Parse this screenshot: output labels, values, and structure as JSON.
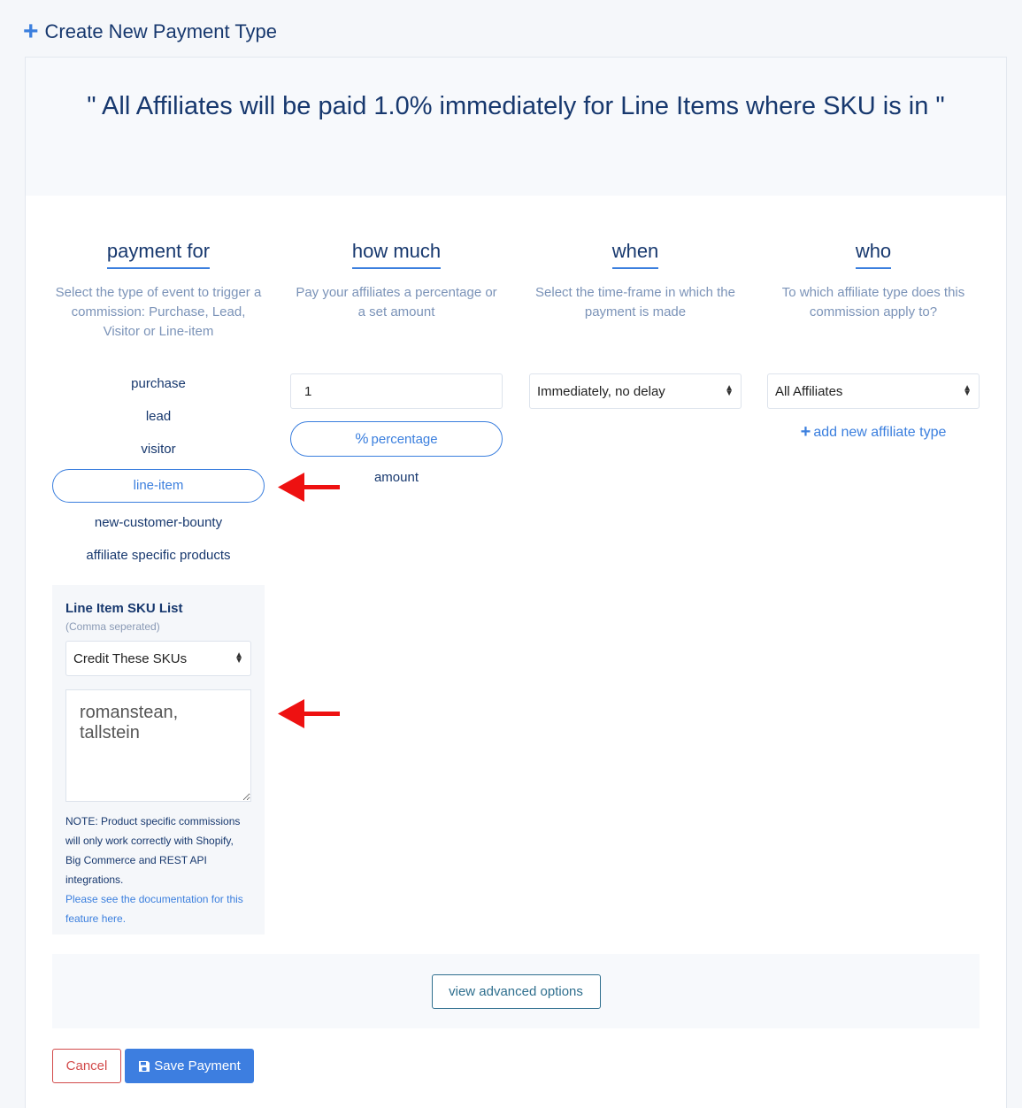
{
  "header": {
    "title": "Create New Payment Type",
    "icon": "plus-icon"
  },
  "summary": "\" All Affiliates will be paid 1.0% immediately for Line Items where SKU is in \"",
  "columns": {
    "payment_for": {
      "title": "payment for",
      "desc": "Select the type of event to trigger a commission: Purchase, Lead, Visitor or Line-item"
    },
    "how_much": {
      "title": "how much",
      "desc": "Pay your affiliates a percentage or a set amount"
    },
    "when": {
      "title": "when",
      "desc": "Select the time-frame in which the payment is made"
    },
    "who": {
      "title": "who",
      "desc": "To which affiliate type does this commission apply to?"
    }
  },
  "payment_options": [
    "purchase",
    "lead",
    "visitor",
    "line-item",
    "new-customer-bounty",
    "affiliate specific products"
  ],
  "selected_payment_option": "line-item",
  "sku": {
    "title": "Line Item SKU List",
    "subtitle": "(Comma seperated)",
    "mode": "Credit These SKUs",
    "value": "romanstean, tallstein",
    "note": "NOTE: Product specific commissions will only work correctly with Shopify, Big Commerce and REST API integrations.",
    "doc_link": "Please see the documentation for this feature here."
  },
  "how_much": {
    "value": "1",
    "percentage_label": "percentage",
    "amount_label": "amount",
    "selected": "percentage"
  },
  "when": {
    "selected": "Immediately, no delay"
  },
  "who": {
    "selected": "All Affiliates",
    "add_label": "add new affiliate type"
  },
  "buttons": {
    "advanced": "view advanced options",
    "cancel": "Cancel",
    "save": "Save Payment"
  },
  "colors": {
    "accent": "#3b7fde",
    "navy": "#17386e",
    "danger": "#d24a4a",
    "arrow": "#ee1111"
  }
}
